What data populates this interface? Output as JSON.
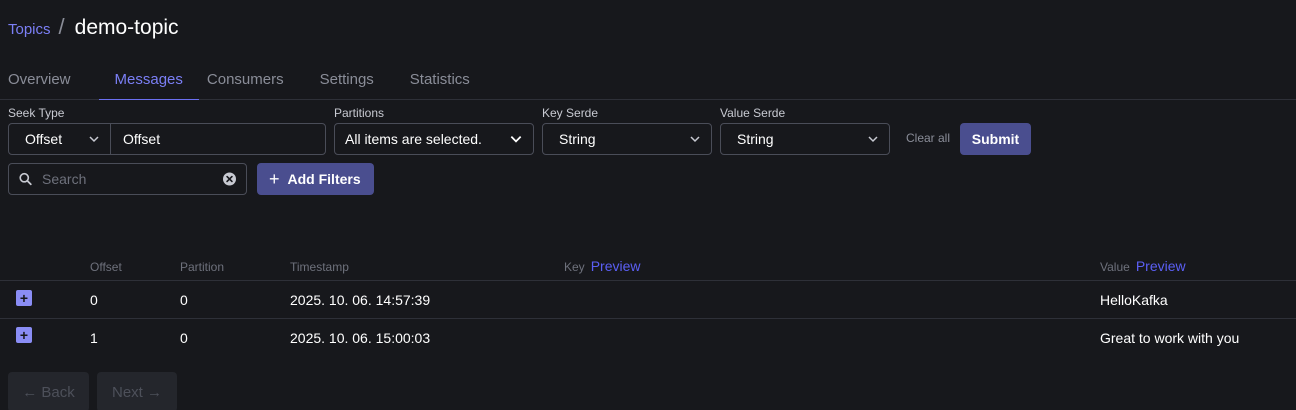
{
  "breadcrumb": {
    "parent": "Topics",
    "separator": "/",
    "current": "demo-topic"
  },
  "tabs": [
    "Overview",
    "Messages",
    "Consumers",
    "Settings",
    "Statistics"
  ],
  "active_tab": "Messages",
  "filters": {
    "seek_type": {
      "label": "Seek Type",
      "selected": "Offset",
      "value": "Offset"
    },
    "partitions": {
      "label": "Partitions",
      "selected": "All items are selected."
    },
    "key_serde": {
      "label": "Key Serde",
      "selected": "String"
    },
    "value_serde": {
      "label": "Value Serde",
      "selected": "String"
    },
    "clear_all": "Clear all",
    "submit": "Submit",
    "search_placeholder": "Search",
    "add_filters": "Add Filters"
  },
  "table": {
    "headers": {
      "offset": "Offset",
      "partition": "Partition",
      "timestamp": "Timestamp",
      "key": "Key",
      "value": "Value",
      "preview": "Preview"
    },
    "rows": [
      {
        "offset": "0",
        "partition": "0",
        "timestamp": "2025. 10. 06. 14:57:39",
        "key": "",
        "value": "HelloKafka"
      },
      {
        "offset": "1",
        "partition": "0",
        "timestamp": "2025. 10. 06. 15:00:03",
        "key": "",
        "value": "Great to work with you"
      }
    ]
  },
  "pagination": {
    "back": "← Back",
    "next": "Next →"
  },
  "colors": {
    "accent": "#7b7ff5",
    "button": "#4a4e8f",
    "background": "#17181c"
  },
  "icons": {
    "chevron": "chevron-down-icon",
    "search": "search-icon",
    "clear": "clear-circle-icon",
    "plus": "plus-icon",
    "expand": "expand-plus-icon"
  }
}
